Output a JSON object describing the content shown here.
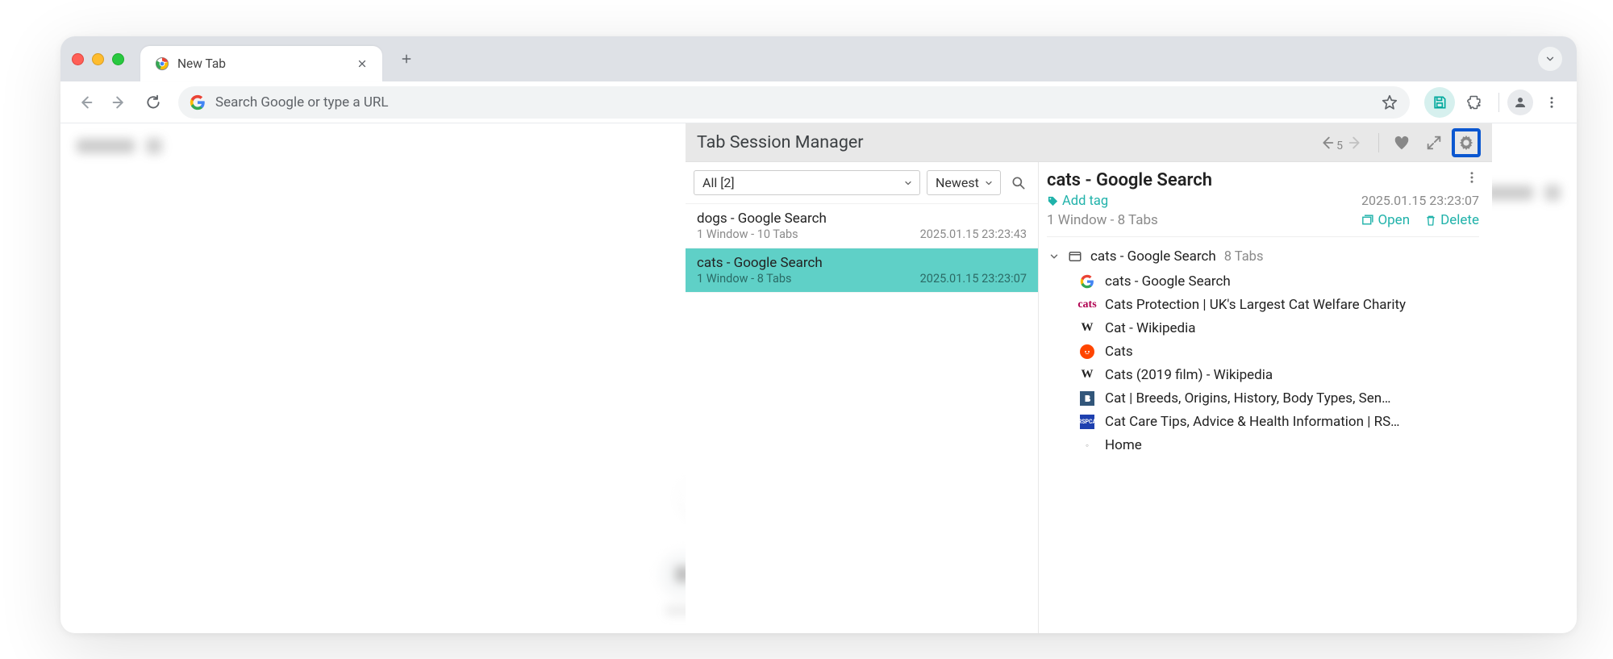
{
  "browser": {
    "tab_title": "New Tab",
    "omnibox_placeholder": "Search Google or type a URL"
  },
  "extension": {
    "title": "Tab Session Manager",
    "history_count": "5",
    "filter_label": "All [2]",
    "sort_label": "Newest"
  },
  "sessions": [
    {
      "title": "dogs - Google Search",
      "summary": "1 Window - 10 Tabs",
      "date": "2025.01.15 23:23:43",
      "selected": false
    },
    {
      "title": "cats - Google Search",
      "summary": "1 Window - 8 Tabs",
      "date": "2025.01.15 23:23:07",
      "selected": true
    }
  ],
  "detail": {
    "title": "cats - Google Search",
    "add_tag": "Add tag",
    "date": "2025.01.15 23:23:07",
    "summary": "1 Window - 8 Tabs",
    "open_label": "Open",
    "delete_label": "Delete",
    "window_label": "cats - Google Search",
    "window_tabcount": "8 Tabs",
    "tabs": [
      {
        "icon": "google",
        "title": "cats - Google Search"
      },
      {
        "icon": "cats",
        "title": "Cats Protection | UK's Largest Cat Welfare Charity"
      },
      {
        "icon": "wiki",
        "title": "Cat - Wikipedia"
      },
      {
        "icon": "reddit",
        "title": "Cats"
      },
      {
        "icon": "wiki",
        "title": "Cats (2019 film) - Wikipedia"
      },
      {
        "icon": "brit",
        "title": "Cat | Breeds, Origins, History, Body Types, Sen…"
      },
      {
        "icon": "rspca",
        "title": "Cat Care Tips, Advice & Health Information | RS…"
      },
      {
        "icon": "home",
        "title": "Home"
      }
    ]
  }
}
